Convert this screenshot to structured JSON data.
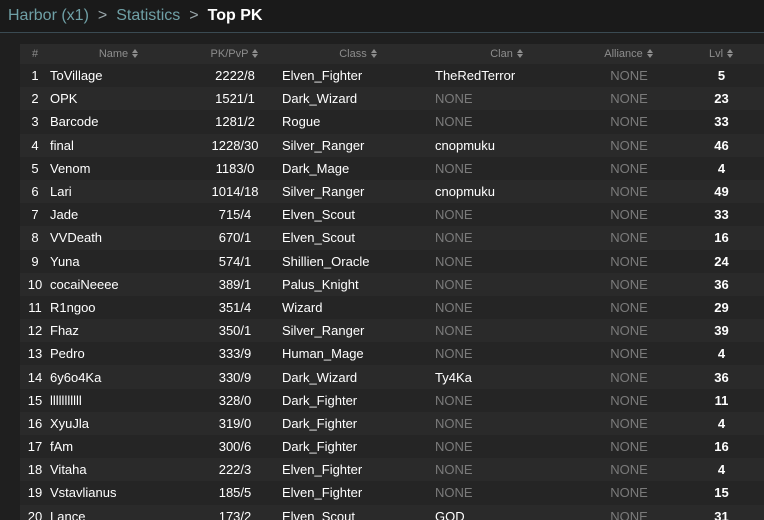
{
  "breadcrumb": {
    "items": [
      "Harbor (x1)",
      "Statistics"
    ],
    "separator": ">",
    "current": "Top PK"
  },
  "table": {
    "headers": [
      "#",
      "Name",
      "PK/PvP",
      "Class",
      "Clan",
      "Alliance",
      "Lvl"
    ],
    "rows": [
      {
        "num": "1",
        "name": "ToVillage",
        "pk": "2222/8",
        "class": "Elven_Fighter",
        "clan": "TheRedTerror",
        "alliance": "NONE",
        "lvl": "5"
      },
      {
        "num": "2",
        "name": "OPK",
        "pk": "1521/1",
        "class": "Dark_Wizard",
        "clan": "NONE",
        "alliance": "NONE",
        "lvl": "23"
      },
      {
        "num": "3",
        "name": "Barcode",
        "pk": "1281/2",
        "class": "Rogue",
        "clan": "NONE",
        "alliance": "NONE",
        "lvl": "33"
      },
      {
        "num": "4",
        "name": "final",
        "pk": "1228/30",
        "class": "Silver_Ranger",
        "clan": "cnopmuku",
        "alliance": "NONE",
        "lvl": "46"
      },
      {
        "num": "5",
        "name": "Venom",
        "pk": "1183/0",
        "class": "Dark_Mage",
        "clan": "NONE",
        "alliance": "NONE",
        "lvl": "4"
      },
      {
        "num": "6",
        "name": "Lari",
        "pk": "1014/18",
        "class": "Silver_Ranger",
        "clan": "cnopmuku",
        "alliance": "NONE",
        "lvl": "49"
      },
      {
        "num": "7",
        "name": "Jade",
        "pk": "715/4",
        "class": "Elven_Scout",
        "clan": "NONE",
        "alliance": "NONE",
        "lvl": "33"
      },
      {
        "num": "8",
        "name": "VVDeath",
        "pk": "670/1",
        "class": "Elven_Scout",
        "clan": "NONE",
        "alliance": "NONE",
        "lvl": "16"
      },
      {
        "num": "9",
        "name": "Yuna",
        "pk": "574/1",
        "class": "Shillien_Oracle",
        "clan": "NONE",
        "alliance": "NONE",
        "lvl": "24"
      },
      {
        "num": "10",
        "name": "cocaiNeeee",
        "pk": "389/1",
        "class": "Palus_Knight",
        "clan": "NONE",
        "alliance": "NONE",
        "lvl": "36"
      },
      {
        "num": "11",
        "name": "R1ngoo",
        "pk": "351/4",
        "class": "Wizard",
        "clan": "NONE",
        "alliance": "NONE",
        "lvl": "29"
      },
      {
        "num": "12",
        "name": "Fhaz",
        "pk": "350/1",
        "class": "Silver_Ranger",
        "clan": "NONE",
        "alliance": "NONE",
        "lvl": "39"
      },
      {
        "num": "13",
        "name": "Pedro",
        "pk": "333/9",
        "class": "Human_Mage",
        "clan": "NONE",
        "alliance": "NONE",
        "lvl": "4"
      },
      {
        "num": "14",
        "name": "6y6o4Ka",
        "pk": "330/9",
        "class": "Dark_Wizard",
        "clan": "Ty4Ka",
        "alliance": "NONE",
        "lvl": "36"
      },
      {
        "num": "15",
        "name": "lllllllllll",
        "pk": "328/0",
        "class": "Dark_Fighter",
        "clan": "NONE",
        "alliance": "NONE",
        "lvl": "11"
      },
      {
        "num": "16",
        "name": "XyuJla",
        "pk": "319/0",
        "class": "Dark_Fighter",
        "clan": "NONE",
        "alliance": "NONE",
        "lvl": "4"
      },
      {
        "num": "17",
        "name": "fAm",
        "pk": "300/6",
        "class": "Dark_Fighter",
        "clan": "NONE",
        "alliance": "NONE",
        "lvl": "16"
      },
      {
        "num": "18",
        "name": "Vitaha",
        "pk": "222/3",
        "class": "Elven_Fighter",
        "clan": "NONE",
        "alliance": "NONE",
        "lvl": "4"
      },
      {
        "num": "19",
        "name": "Vstavlianus",
        "pk": "185/5",
        "class": "Elven_Fighter",
        "clan": "NONE",
        "alliance": "NONE",
        "lvl": "15"
      },
      {
        "num": "20",
        "name": "Lance",
        "pk": "173/2",
        "class": "Elven_Scout",
        "clan": "GOD",
        "alliance": "NONE",
        "lvl": "31"
      }
    ]
  },
  "colors": {
    "background": "#1f1f1f",
    "crumb_link": "#6fa0a6",
    "none_text": "#7b7b7b"
  }
}
